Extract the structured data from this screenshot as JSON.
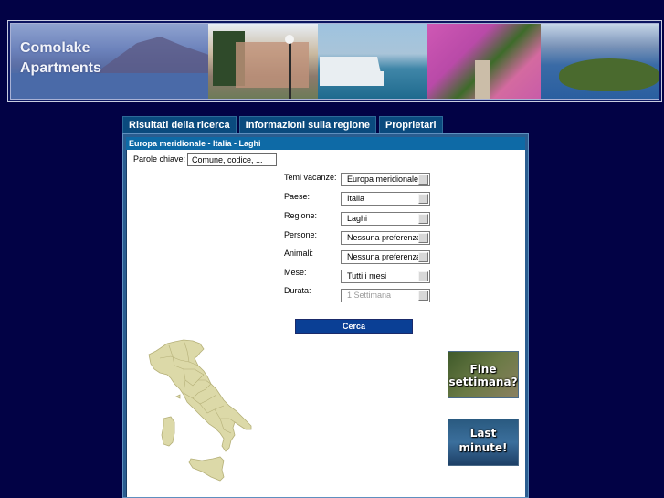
{
  "banner": {
    "brand_line1": "Comolake",
    "brand_line2": "Apartments",
    "photos": [
      "lake-mountains-photo",
      "village-lamppost-photo",
      "ferry-boat-photo",
      "bougainvillea-path-photo",
      "lake-peninsula-photo"
    ]
  },
  "tabs": [
    {
      "label": "Risultati della ricerca"
    },
    {
      "label": "Informazioni sulla regione"
    },
    {
      "label": "Proprietari"
    }
  ],
  "panel": {
    "breadcrumb": "Europa meridionale - Italia - Laghi"
  },
  "search": {
    "keywords_label": "Parole chiave:",
    "keywords_placeholder": "Comune, codice, ...",
    "fields": [
      {
        "label": "Temi vacanze:",
        "value": "Europa meridionale",
        "disabled": false
      },
      {
        "label": "Paese:",
        "value": "Italia",
        "disabled": false
      },
      {
        "label": "Regione:",
        "value": "Laghi",
        "disabled": false
      },
      {
        "label": "Persone:",
        "value": "Nessuna preferenza",
        "disabled": false
      },
      {
        "label": "Animali:",
        "value": "Nessuna preferenza",
        "disabled": false
      },
      {
        "label": "Mese:",
        "value": "Tutti i mesi",
        "disabled": false
      },
      {
        "label": "Durata:",
        "value": "1 Settimana",
        "disabled": true
      }
    ],
    "submit_label": "Cerca"
  },
  "promos": [
    {
      "line1": "Fine",
      "line2": "settimana?"
    },
    {
      "line1": "Last",
      "line2": "minute!"
    }
  ],
  "colors": {
    "page_bg": "#020245",
    "tab_bg": "#0a4a7e",
    "panel_header": "#0e6aa6",
    "button_bg": "#0a3f95",
    "map_fill": "#dcd9a8"
  }
}
